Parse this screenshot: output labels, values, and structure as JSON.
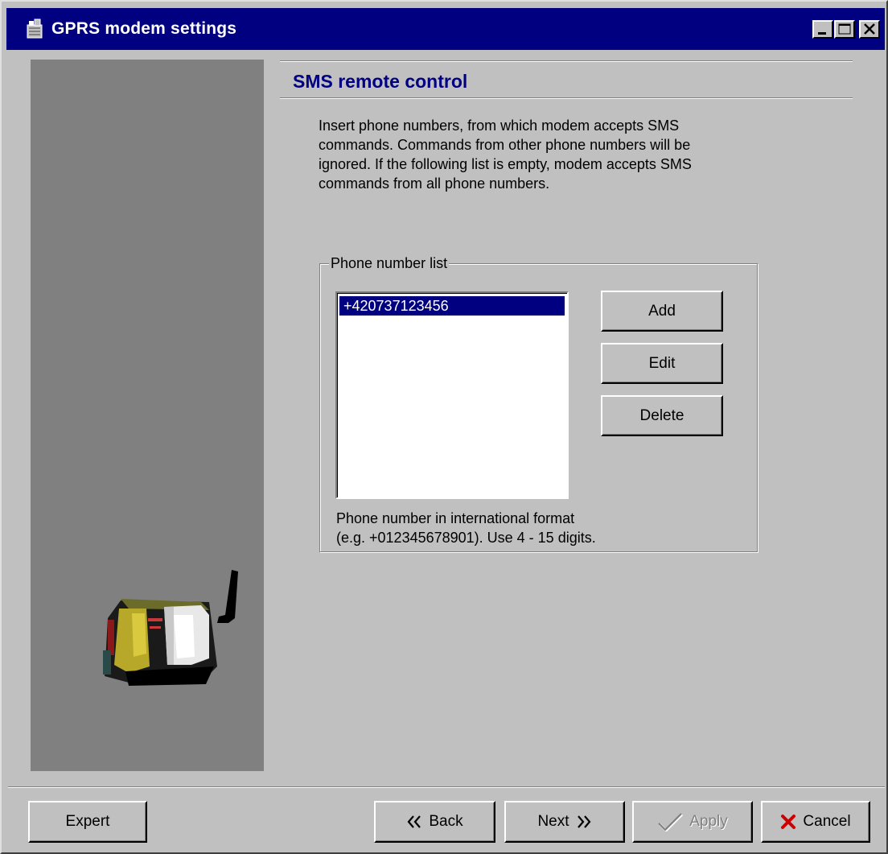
{
  "window": {
    "title": "GPRS modem settings",
    "icon": "modem-app-icon",
    "controls": [
      "minimize-icon",
      "maximize-icon",
      "close-icon"
    ]
  },
  "section": {
    "title": "SMS remote control",
    "intro_lines": [
      "Insert phone numbers, from which modem accepts SMS",
      "commands. Commands from other phone numbers will be",
      "ignored. If the following list is empty, modem accepts SMS",
      "commands from all phone numbers."
    ]
  },
  "phone_list": {
    "group_label": "Phone number list",
    "items": [
      "+420737123456"
    ],
    "selected_index": 0,
    "buttons": {
      "add": "Add",
      "edit": "Edit",
      "delete": "Delete"
    },
    "hint_lines": [
      "Phone number in international format",
      "(e.g. +012345678901). Use 4 - 15 digits."
    ]
  },
  "footer": {
    "expert": "Expert",
    "back": "Back",
    "next": "Next",
    "apply": "Apply",
    "cancel": "Cancel",
    "apply_enabled": false
  },
  "colors": {
    "titlebar": "#000080",
    "face": "#c0c0c0",
    "side_panel": "#808080",
    "section_title": "#000080",
    "selection": "#000080",
    "cancel_icon": "#cc0000"
  }
}
